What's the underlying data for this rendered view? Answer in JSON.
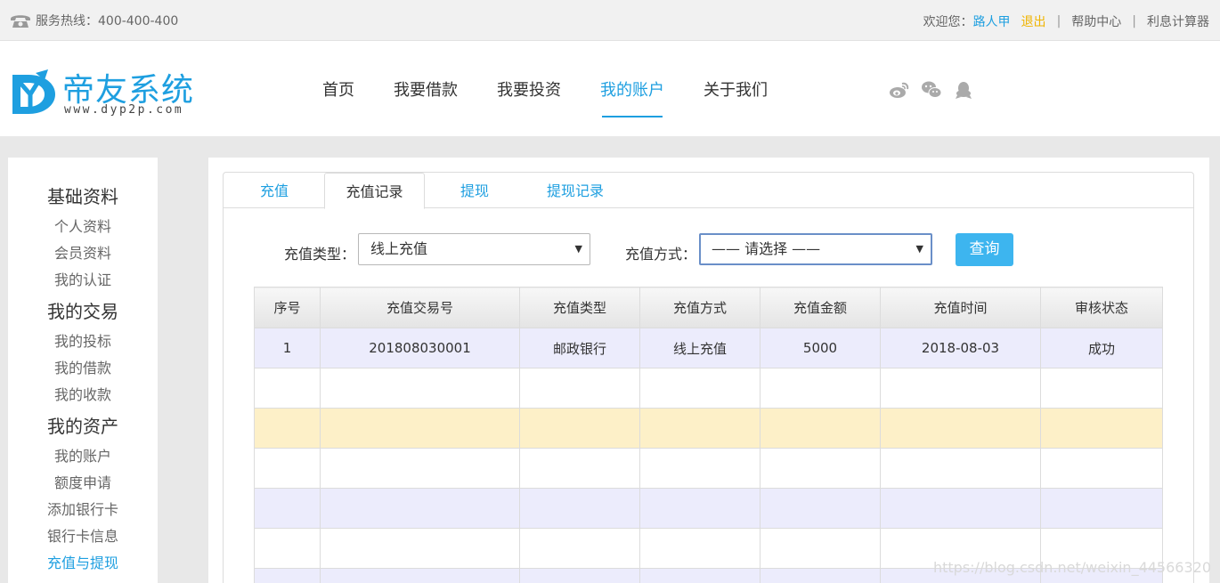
{
  "topbar": {
    "hotline_label": "服务热线：400-400-400",
    "welcome": "欢迎您：",
    "username": "路人甲",
    "logout": "退出",
    "help_center": "帮助中心",
    "interest_calculator": "利息计算器",
    "separator": "|"
  },
  "header": {
    "logo_name": "帝友系统",
    "logo_url": "www.dyp2p.com",
    "nav": [
      "首页",
      "我要借款",
      "我要投资",
      "我的账户",
      "关于我们"
    ],
    "active_nav": "我的账户",
    "social_icons": [
      "weibo-icon",
      "wechat-icon",
      "qq-icon"
    ]
  },
  "sidebar": {
    "groups": [
      {
        "title": "基础资料",
        "items": [
          "个人资料",
          "会员资料",
          "我的认证"
        ]
      },
      {
        "title": "我的交易",
        "items": [
          "我的投标",
          "我的借款",
          "我的收款"
        ]
      },
      {
        "title": "我的资产",
        "items": [
          "我的账户",
          "额度申请",
          "添加银行卡",
          "银行卡信息",
          "充值与提现"
        ]
      }
    ],
    "active_item": "充值与提现"
  },
  "tabs": [
    "充值",
    "充值记录",
    "提现",
    "提现记录"
  ],
  "active_tab": "充值记录",
  "filters": {
    "type_label": "充值类型：",
    "type_value": "线上充值",
    "method_label": "充值方式：",
    "method_value": "—— 请选择 ——",
    "query_button": "查询"
  },
  "table": {
    "columns": [
      "序号",
      "充值交易号",
      "充值类型",
      "充值方式",
      "充值金额",
      "充值时间",
      "审核状态"
    ],
    "rows": [
      [
        "1",
        "201808030001",
        "邮政银行",
        "线上充值",
        "5000",
        "2018-08-03",
        "成功"
      ]
    ]
  },
  "watermark": "https://blog.csdn.net/weixin_44566320",
  "colors": {
    "accent": "#1e9fe0",
    "button": "#3db5ef",
    "row_alt": "#ececfc",
    "row_highlight": "#fdf0c8",
    "logout": "#f0b400"
  }
}
